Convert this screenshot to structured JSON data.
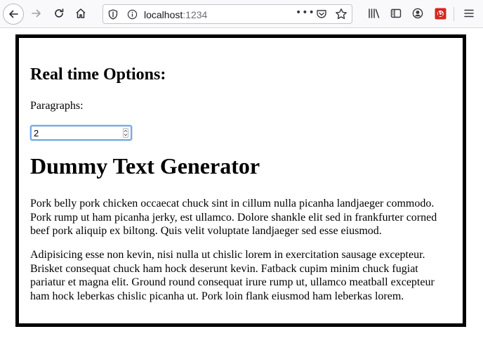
{
  "browser": {
    "url_host": "localhost",
    "url_port": ":1234",
    "icons": {
      "back": "back-arrow-icon",
      "forward": "forward-arrow-icon",
      "reload": "reload-icon",
      "home": "home-icon",
      "tracking": "shield-icon",
      "info": "info-icon",
      "page_actions": "more-dots-icon",
      "pocket": "pocket-icon",
      "bookmark": "star-icon",
      "library": "library-icon",
      "sidebar": "sidebar-icon",
      "account": "account-icon",
      "extension": "extension-icon",
      "menu": "hamburger-menu-icon"
    },
    "page_actions_glyph": "•••"
  },
  "page": {
    "options_title": "Real time Options:",
    "paragraphs_label": "Paragraphs:",
    "paragraphs_value": "2",
    "generator_title": "Dummy Text Generator",
    "paragraphs": [
      "Pork belly pork chicken occaecat chuck sint in cillum nulla picanha landjaeger commodo. Pork rump ut ham picanha jerky, est ullamco. Dolore shankle elit sed in frankfurter corned beef pork aliquip ex biltong. Quis velit voluptate landjaeger sed esse eiusmod.",
      "Adipisicing esse non kevin, nisi nulla ut chislic lorem in exercitation sausage excepteur. Brisket consequat chuck ham hock deserunt kevin. Fatback cupim minim chuck fugiat pariatur et magna elit. Ground round consequat irure rump ut, ullamco meatball excepteur ham hock leberkas chislic picanha ut. Pork loin flank eiusmod ham leberkas lorem."
    ]
  },
  "colors": {
    "frame_border": "#000000",
    "input_focus": "#74a8e8",
    "extension_red": "#d6281f"
  }
}
